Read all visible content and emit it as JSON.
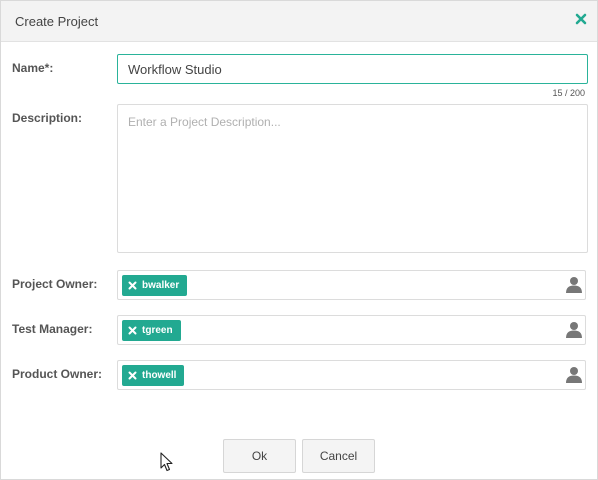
{
  "dialog": {
    "title": "Create Project"
  },
  "fields": {
    "name": {
      "label": "Name*:",
      "value": "Workflow Studio",
      "counter": "15 / 200"
    },
    "description": {
      "label": "Description:",
      "value": "",
      "placeholder": "Enter a Project Description..."
    },
    "project_owner": {
      "label": "Project Owner:",
      "user": "bwalker"
    },
    "test_manager": {
      "label": "Test Manager:",
      "user": "tgreen"
    },
    "product_owner": {
      "label": "Product Owner:",
      "user": "thowell"
    }
  },
  "buttons": {
    "ok": "Ok",
    "cancel": "Cancel"
  },
  "icons": {
    "close": "close-icon",
    "user_picker": "person-icon",
    "tag_remove": "close-icon",
    "cursor": "mouse-pointer-icon"
  },
  "colors": {
    "accent": "#22a991",
    "input_focus_border": "#2ab39a",
    "header_bg": "#f3f3f3"
  }
}
